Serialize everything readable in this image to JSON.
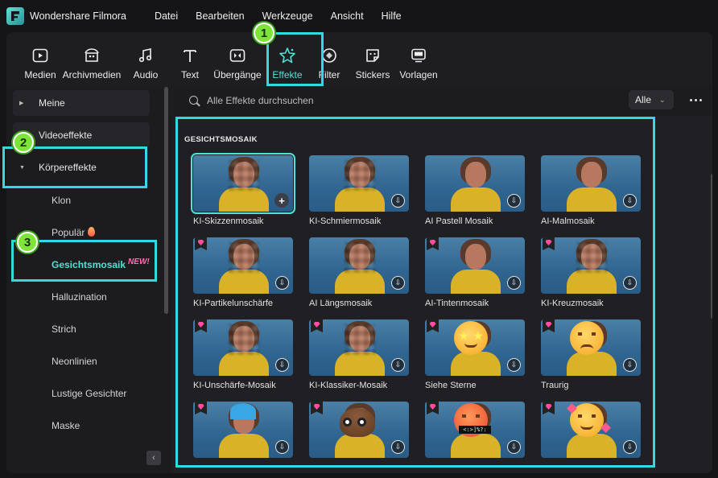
{
  "app": {
    "title": "Wondershare Filmora"
  },
  "menu": [
    "Datei",
    "Bearbeiten",
    "Werkzeuge",
    "Ansicht",
    "Hilfe"
  ],
  "toolbar": [
    {
      "label": "Medien",
      "icon": "media-icon"
    },
    {
      "label": "Archivmedien",
      "icon": "stock-media-icon"
    },
    {
      "label": "Audio",
      "icon": "music-note-icon"
    },
    {
      "label": "Text",
      "icon": "text-icon"
    },
    {
      "label": "Übergänge",
      "icon": "transition-icon"
    },
    {
      "label": "Effekte",
      "icon": "effects-star-icon",
      "active": true
    },
    {
      "label": "Filter",
      "icon": "filter-icon"
    },
    {
      "label": "Stickers",
      "icon": "sticker-icon"
    },
    {
      "label": "Vorlagen",
      "icon": "template-icon"
    }
  ],
  "sidebar": {
    "groups": [
      "Meine",
      "Videoeffekte",
      "Körpereffekte"
    ],
    "sub_items": [
      "Klon",
      "Populär",
      "Gesichtsmosaik",
      "Halluzination",
      "Strich",
      "Neonlinien",
      "Lustige Gesichter",
      "Maske"
    ],
    "new_badge": "NEW!",
    "active_sub": "Gesichtsmosaik"
  },
  "search": {
    "placeholder": "Alle Effekte durchsuchen"
  },
  "filter": {
    "selected": "Alle"
  },
  "section": {
    "title": "GESICHTSMOSAIK"
  },
  "effects": [
    {
      "label": "KI-Skizzenmosaik",
      "style": "mosaic",
      "premium": false,
      "action": "add"
    },
    {
      "label": "KI-Schmiermosaik",
      "style": "mosaic",
      "premium": false,
      "action": "download"
    },
    {
      "label": "AI Pastell Mosaik",
      "style": "plain",
      "premium": false,
      "action": "download"
    },
    {
      "label": "AI-Malmosaik",
      "style": "plain",
      "premium": false,
      "action": "download"
    },
    {
      "label": "KI-Partikelunschärfe",
      "style": "mosaic",
      "premium": true,
      "action": "download"
    },
    {
      "label": "AI Längsmosaik",
      "style": "mosaic",
      "premium": false,
      "action": "download"
    },
    {
      "label": "AI-Tintenmosaik",
      "style": "plain",
      "premium": true,
      "action": "download"
    },
    {
      "label": "KI-Kreuzmosaik",
      "style": "mosaic",
      "premium": true,
      "action": "download"
    },
    {
      "label": "KI-Unschärfe-Mosaik",
      "style": "mosaic",
      "premium": true,
      "action": "download"
    },
    {
      "label": "KI-Klassiker-Mosaik",
      "style": "mosaic",
      "premium": true,
      "action": "download"
    },
    {
      "label": "Siehe Sterne",
      "style": "stars",
      "premium": true,
      "action": "download"
    },
    {
      "label": "Traurig",
      "style": "sad",
      "premium": true,
      "action": "download"
    },
    {
      "label": "",
      "style": "wifi",
      "premium": true,
      "action": "download"
    },
    {
      "label": "",
      "style": "poop",
      "premium": true,
      "action": "download"
    },
    {
      "label": "",
      "style": "angry",
      "premium": true,
      "action": "download",
      "mask_text": "<:>]%?:"
    },
    {
      "label": "",
      "style": "smile",
      "premium": true,
      "action": "download"
    }
  ],
  "annotations": [
    "1",
    "2",
    "3"
  ],
  "colors": {
    "accent": "#4fe3d5",
    "highlight": "#33d8e4",
    "step_badge": "#7ee43a",
    "premium": "#ff4fa0"
  }
}
